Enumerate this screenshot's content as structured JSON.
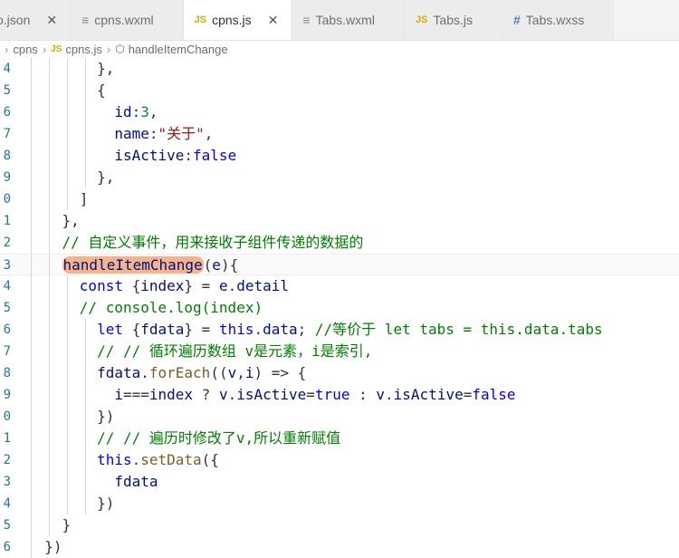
{
  "tabs": [
    {
      "label": "o.json",
      "icon": "json-file-icon",
      "kind": "plain",
      "active": false,
      "close": "✕"
    },
    {
      "label": "cpns.wxml",
      "icon": "lines-file-icon",
      "kind": "lines",
      "active": false,
      "close": ""
    },
    {
      "label": "cpns.js",
      "icon": "js-file-icon",
      "kind": "js",
      "active": true,
      "close": "✕"
    },
    {
      "label": "Tabs.wxml",
      "icon": "lines-file-icon",
      "kind": "lines",
      "active": false,
      "close": ""
    },
    {
      "label": "Tabs.js",
      "icon": "js-file-icon",
      "kind": "js",
      "active": false,
      "close": ""
    },
    {
      "label": "Tabs.wxss",
      "icon": "hash-file-icon",
      "kind": "hash",
      "active": false,
      "close": ""
    }
  ],
  "breadcrumb": {
    "folder": "cpns",
    "file": "cpns.js",
    "symbol": "handleItemChange",
    "js_badge": "JS"
  },
  "editor": {
    "lines": [
      {
        "num": "4",
        "tokens": [
          [
            "punc",
            "        },"
          ]
        ]
      },
      {
        "num": "5",
        "tokens": [
          [
            "punc",
            "        {"
          ]
        ]
      },
      {
        "num": "6",
        "tokens": [
          [
            "punc",
            "          "
          ],
          [
            "prop",
            "id"
          ],
          [
            "punc",
            ":"
          ],
          [
            "num",
            "3"
          ],
          [
            "punc",
            ","
          ]
        ]
      },
      {
        "num": "7",
        "tokens": [
          [
            "punc",
            "          "
          ],
          [
            "prop",
            "name"
          ],
          [
            "punc",
            ":"
          ],
          [
            "str",
            "\"关于\""
          ],
          [
            "punc",
            ","
          ]
        ]
      },
      {
        "num": "8",
        "tokens": [
          [
            "punc",
            "          "
          ],
          [
            "prop",
            "isActive"
          ],
          [
            "punc",
            ":"
          ],
          [
            "kw",
            "false"
          ]
        ]
      },
      {
        "num": "9",
        "tokens": [
          [
            "punc",
            "        },"
          ]
        ]
      },
      {
        "num": "0",
        "tokens": [
          [
            "punc",
            "      ]"
          ]
        ]
      },
      {
        "num": "1",
        "tokens": [
          [
            "punc",
            "    },"
          ]
        ]
      },
      {
        "num": "2",
        "tokens": [
          [
            "punc",
            "    "
          ],
          [
            "cmt",
            "// 自定义事件，用来接收子组件传递的数据的"
          ]
        ]
      },
      {
        "num": "3",
        "current": true,
        "tokens": [
          [
            "punc",
            "    "
          ],
          [
            "fn-hl",
            "handleItemChange"
          ],
          [
            "punc",
            "("
          ],
          [
            "var",
            "e"
          ],
          [
            "punc",
            "){"
          ]
        ]
      },
      {
        "num": "4",
        "tokens": [
          [
            "punc",
            "      "
          ],
          [
            "kw",
            "const"
          ],
          [
            "punc",
            " {"
          ],
          [
            "var",
            "index"
          ],
          [
            "punc",
            "} = "
          ],
          [
            "var",
            "e"
          ],
          [
            "punc",
            "."
          ],
          [
            "prop",
            "detail"
          ]
        ]
      },
      {
        "num": "5",
        "tokens": [
          [
            "punc",
            "      "
          ],
          [
            "cmt",
            "// console.log(index)"
          ]
        ]
      },
      {
        "num": "6",
        "tokens": [
          [
            "punc",
            "        "
          ],
          [
            "kw",
            "let"
          ],
          [
            "punc",
            " {"
          ],
          [
            "var",
            "fdata"
          ],
          [
            "punc",
            "} = "
          ],
          [
            "kw",
            "this"
          ],
          [
            "punc",
            "."
          ],
          [
            "prop",
            "data"
          ],
          [
            "punc",
            "; "
          ],
          [
            "cmt",
            "//等价于 let tabs = this.data.tabs"
          ]
        ]
      },
      {
        "num": "7",
        "tokens": [
          [
            "punc",
            "        "
          ],
          [
            "cmt",
            "// // 循环遍历数组 v是元素，i是索引,"
          ]
        ]
      },
      {
        "num": "8",
        "tokens": [
          [
            "punc",
            "        "
          ],
          [
            "var",
            "fdata"
          ],
          [
            "punc",
            "."
          ],
          [
            "fn",
            "forEach"
          ],
          [
            "punc",
            "(("
          ],
          [
            "var",
            "v"
          ],
          [
            "punc",
            ","
          ],
          [
            "var",
            "i"
          ],
          [
            "punc",
            ") => {"
          ]
        ]
      },
      {
        "num": "9",
        "tokens": [
          [
            "punc",
            "          "
          ],
          [
            "var",
            "i"
          ],
          [
            "punc",
            "==="
          ],
          [
            "var",
            "index"
          ],
          [
            "punc",
            " ? "
          ],
          [
            "var",
            "v"
          ],
          [
            "punc",
            "."
          ],
          [
            "prop",
            "isActive"
          ],
          [
            "punc",
            "="
          ],
          [
            "kw",
            "true"
          ],
          [
            "punc",
            " : "
          ],
          [
            "var",
            "v"
          ],
          [
            "punc",
            "."
          ],
          [
            "prop",
            "isActive"
          ],
          [
            "punc",
            "="
          ],
          [
            "kw",
            "false"
          ]
        ]
      },
      {
        "num": "0",
        "tokens": [
          [
            "punc",
            "        })"
          ]
        ]
      },
      {
        "num": "1",
        "tokens": [
          [
            "punc",
            "        "
          ],
          [
            "cmt",
            "// // 遍历时修改了v,所以重新赋值"
          ]
        ]
      },
      {
        "num": "2",
        "tokens": [
          [
            "punc",
            "        "
          ],
          [
            "kw",
            "this"
          ],
          [
            "punc",
            "."
          ],
          [
            "fn",
            "setData"
          ],
          [
            "punc",
            "({"
          ]
        ]
      },
      {
        "num": "3",
        "tokens": [
          [
            "punc",
            "          "
          ],
          [
            "var",
            "fdata"
          ]
        ]
      },
      {
        "num": "4",
        "tokens": [
          [
            "punc",
            "        })"
          ]
        ]
      },
      {
        "num": "5",
        "tokens": [
          [
            "punc",
            "    }"
          ]
        ]
      },
      {
        "num": "6",
        "tokens": [
          [
            "punc",
            "  })"
          ]
        ]
      }
    ]
  }
}
